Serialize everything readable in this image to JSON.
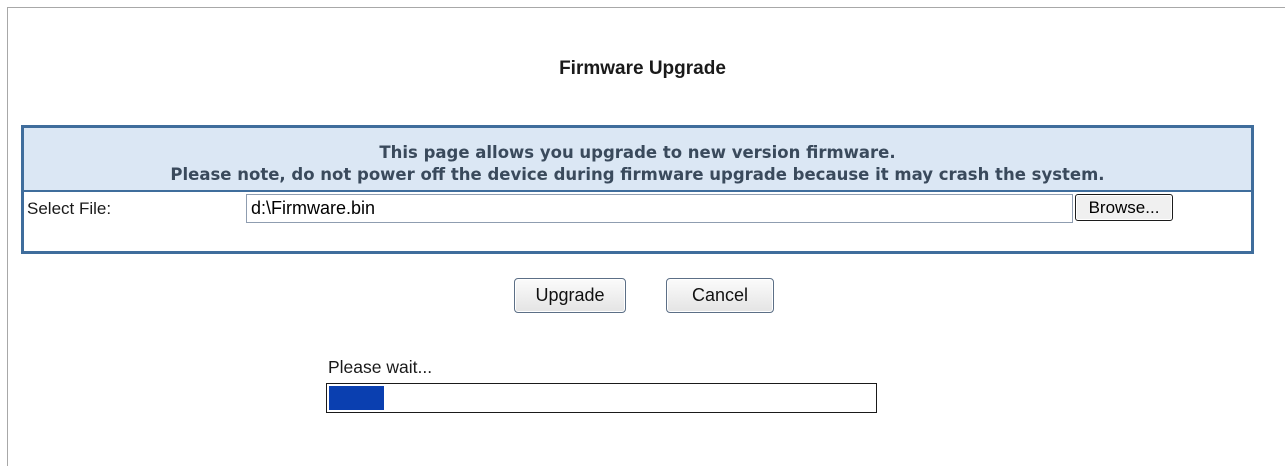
{
  "page": {
    "title": "Firmware Upgrade"
  },
  "notice": {
    "line1": "This page allows you upgrade to new version firmware.",
    "line2": "Please note, do not power off the device during firmware upgrade because it may crash the system."
  },
  "file_select": {
    "label": "Select File:",
    "value": "d:\\Firmware.bin",
    "browse_label": "Browse..."
  },
  "actions": {
    "upgrade_label": "Upgrade",
    "cancel_label": "Cancel"
  },
  "progress": {
    "status_text": "Please wait...",
    "percent": 10
  },
  "colors": {
    "panel_border": "#3f6d9c",
    "notice_background": "#dbe7f4",
    "notice_text": "#3a4a5c",
    "progress_fill": "#0a3fb0"
  }
}
